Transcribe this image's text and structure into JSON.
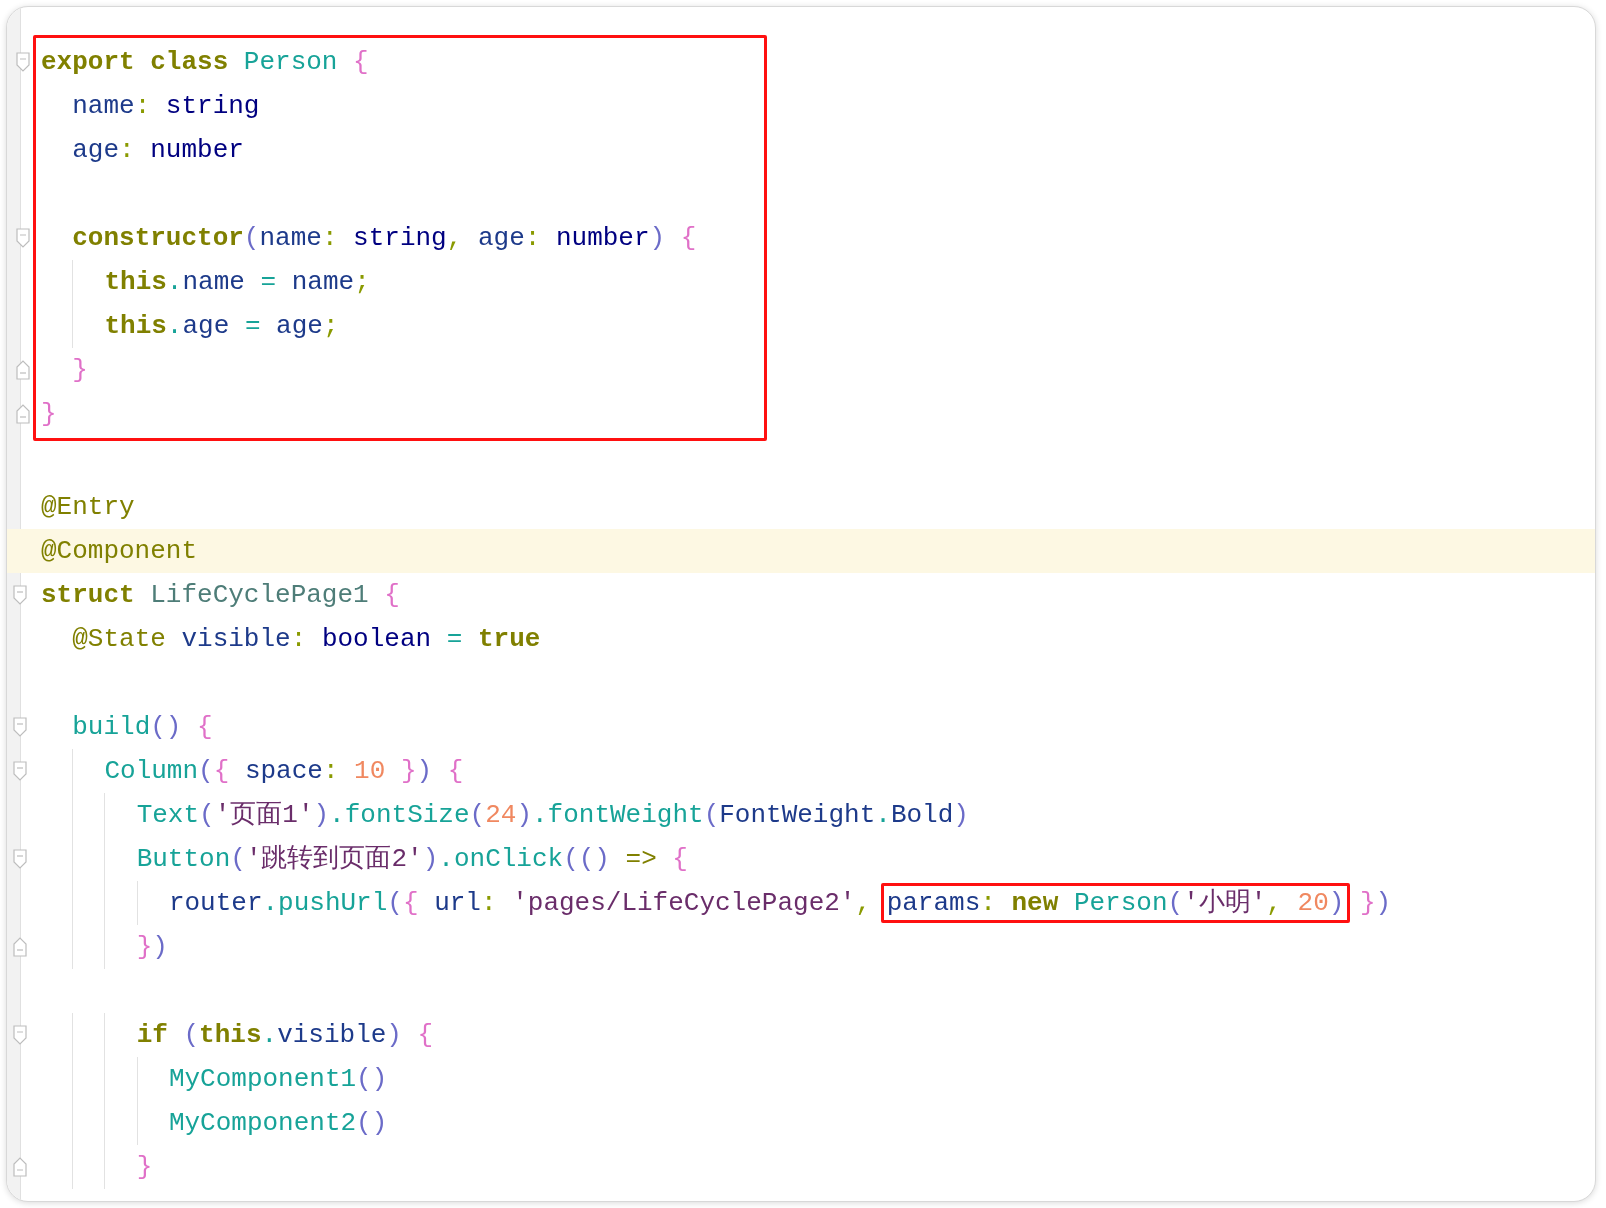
{
  "blocks": [
    {
      "boxed": true,
      "lines": [
        {
          "fold_open": true,
          "tokens": [
            {
              "text": "export",
              "kind": "keyword"
            },
            {
              "text": " class",
              "kind": "keyword"
            },
            {
              "text": " Person",
              "kind": "class"
            },
            {
              "text": " {",
              "kind": "brace"
            }
          ]
        },
        {
          "tokens": [
            {
              "text": "  name",
              "kind": "field"
            },
            {
              "text": ":",
              "kind": "colon"
            },
            {
              "text": " string",
              "kind": "type"
            }
          ]
        },
        {
          "tokens": [
            {
              "text": "  age",
              "kind": "field"
            },
            {
              "text": ":",
              "kind": "colon"
            },
            {
              "text": " number",
              "kind": "type"
            }
          ]
        },
        {
          "gap_before": true,
          "fold_open": true,
          "tokens": [
            {
              "text": "  constructor",
              "kind": "keyword"
            },
            {
              "text": "(",
              "kind": "paren"
            },
            {
              "text": "name",
              "kind": "field"
            },
            {
              "text": ":",
              "kind": "colon"
            },
            {
              "text": " string",
              "kind": "type"
            },
            {
              "text": ",",
              "kind": "colon"
            },
            {
              "text": " age",
              "kind": "field"
            },
            {
              "text": ":",
              "kind": "colon"
            },
            {
              "text": " number",
              "kind": "type"
            },
            {
              "text": ")",
              "kind": "paren"
            },
            {
              "text": " {",
              "kind": "brace"
            }
          ]
        },
        {
          "tokens": [
            {
              "text": "    this",
              "kind": "keyword"
            },
            {
              "text": ".",
              "kind": "dot"
            },
            {
              "text": "name",
              "kind": "field"
            },
            {
              "text": " = ",
              "kind": "operator"
            },
            {
              "text": "name",
              "kind": "field"
            },
            {
              "text": ";",
              "kind": "colon"
            }
          ]
        },
        {
          "tokens": [
            {
              "text": "    this",
              "kind": "keyword"
            },
            {
              "text": ".",
              "kind": "dot"
            },
            {
              "text": "age",
              "kind": "field"
            },
            {
              "text": " = ",
              "kind": "operator"
            },
            {
              "text": "age",
              "kind": "field"
            },
            {
              "text": ";",
              "kind": "colon"
            }
          ]
        },
        {
          "fold_close": true,
          "tokens": [
            {
              "text": "  }",
              "kind": "brace"
            }
          ]
        },
        {
          "fold_close": true,
          "tokens": [
            {
              "text": "}",
              "kind": "brace"
            }
          ]
        }
      ]
    },
    {
      "boxed": false,
      "lines": [
        {
          "gap_before": true,
          "tokens": [
            {
              "text": "@Entry",
              "kind": "annotation"
            }
          ]
        },
        {
          "current": true,
          "tokens": [
            {
              "text": "@Component",
              "kind": "annotation"
            }
          ]
        },
        {
          "fold_open": true,
          "tokens": [
            {
              "text": "struct",
              "kind": "keyword"
            },
            {
              "text": " LifeCyclePage1",
              "kind": "struct"
            },
            {
              "text": " {",
              "kind": "brace"
            }
          ]
        },
        {
          "tokens": [
            {
              "text": "  @State",
              "kind": "annotation"
            },
            {
              "text": " visible",
              "kind": "field"
            },
            {
              "text": ":",
              "kind": "colon"
            },
            {
              "text": " boolean",
              "kind": "type"
            },
            {
              "text": " = ",
              "kind": "operator"
            },
            {
              "text": "true",
              "kind": "keyword"
            }
          ]
        },
        {
          "gap_before": true,
          "fold_open": true,
          "tokens": [
            {
              "text": "  build",
              "kind": "function"
            },
            {
              "text": "()",
              "kind": "paren"
            },
            {
              "text": " {",
              "kind": "brace"
            }
          ]
        },
        {
          "fold_open": true,
          "tokens": [
            {
              "text": "    Column",
              "kind": "function"
            },
            {
              "text": "(",
              "kind": "paren"
            },
            {
              "text": "{",
              "kind": "brace"
            },
            {
              "text": " space",
              "kind": "field"
            },
            {
              "text": ":",
              "kind": "colon"
            },
            {
              "text": " 10",
              "kind": "number"
            },
            {
              "text": " }",
              "kind": "brace"
            },
            {
              "text": ")",
              "kind": "paren"
            },
            {
              "text": " {",
              "kind": "brace"
            }
          ]
        },
        {
          "tokens": [
            {
              "text": "      Text",
              "kind": "function"
            },
            {
              "text": "(",
              "kind": "paren"
            },
            {
              "text": "'页面1'",
              "kind": "string"
            },
            {
              "text": ")",
              "kind": "paren"
            },
            {
              "text": ".",
              "kind": "dot"
            },
            {
              "text": "fontSize",
              "kind": "function"
            },
            {
              "text": "(",
              "kind": "paren"
            },
            {
              "text": "24",
              "kind": "number"
            },
            {
              "text": ")",
              "kind": "paren"
            },
            {
              "text": ".",
              "kind": "dot"
            },
            {
              "text": "fontWeight",
              "kind": "function"
            },
            {
              "text": "(",
              "kind": "paren"
            },
            {
              "text": "FontWeight",
              "kind": "field"
            },
            {
              "text": ".",
              "kind": "dot"
            },
            {
              "text": "Bold",
              "kind": "field"
            },
            {
              "text": ")",
              "kind": "paren"
            }
          ]
        },
        {
          "fold_open": true,
          "tokens": [
            {
              "text": "      Button",
              "kind": "function"
            },
            {
              "text": "(",
              "kind": "paren"
            },
            {
              "text": "'跳转到页面2'",
              "kind": "string"
            },
            {
              "text": ")",
              "kind": "paren"
            },
            {
              "text": ".",
              "kind": "dot"
            },
            {
              "text": "onClick",
              "kind": "function"
            },
            {
              "text": "(()",
              "kind": "paren"
            },
            {
              "text": " =>",
              "kind": "arrow"
            },
            {
              "text": " {",
              "kind": "brace"
            }
          ]
        },
        {
          "tokens": [
            {
              "text": "        router",
              "kind": "field"
            },
            {
              "text": ".",
              "kind": "dot"
            },
            {
              "text": "pushUrl",
              "kind": "function"
            },
            {
              "text": "(",
              "kind": "paren"
            },
            {
              "text": "{",
              "kind": "brace"
            },
            {
              "text": " url",
              "kind": "field"
            },
            {
              "text": ":",
              "kind": "colon"
            },
            {
              "text": " 'pages/LifeCyclePage2'",
              "kind": "string"
            },
            {
              "text": ", ",
              "kind": "colon"
            },
            {
              "kind": "group",
              "boxed": true,
              "tokens": [
                {
                  "text": "params",
                  "kind": "field"
                },
                {
                  "text": ":",
                  "kind": "colon"
                },
                {
                  "text": " new",
                  "kind": "keyword"
                },
                {
                  "text": " Person",
                  "kind": "class"
                },
                {
                  "text": "(",
                  "kind": "paren"
                },
                {
                  "text": "'小明'",
                  "kind": "string"
                },
                {
                  "text": ",",
                  "kind": "colon"
                },
                {
                  "text": " 20",
                  "kind": "number"
                },
                {
                  "text": ")",
                  "kind": "paren"
                }
              ]
            },
            {
              "text": " }",
              "kind": "brace"
            },
            {
              "text": ")",
              "kind": "paren"
            }
          ]
        },
        {
          "fold_close": true,
          "tokens": [
            {
              "text": "      }",
              "kind": "brace"
            },
            {
              "text": ")",
              "kind": "paren"
            }
          ]
        },
        {
          "gap_before": true,
          "fold_open": true,
          "tokens": [
            {
              "text": "      if",
              "kind": "keyword"
            },
            {
              "text": " (",
              "kind": "paren"
            },
            {
              "text": "this",
              "kind": "keyword"
            },
            {
              "text": ".",
              "kind": "dot"
            },
            {
              "text": "visible",
              "kind": "field"
            },
            {
              "text": ")",
              "kind": "paren"
            },
            {
              "text": " {",
              "kind": "brace"
            }
          ]
        },
        {
          "tokens": [
            {
              "text": "        MyComponent1",
              "kind": "function"
            },
            {
              "text": "()",
              "kind": "paren"
            }
          ]
        },
        {
          "tokens": [
            {
              "text": "        MyComponent2",
              "kind": "function"
            },
            {
              "text": "()",
              "kind": "paren"
            }
          ]
        },
        {
          "fold_close": true,
          "tokens": [
            {
              "text": "      }",
              "kind": "brace"
            }
          ]
        }
      ]
    }
  ]
}
